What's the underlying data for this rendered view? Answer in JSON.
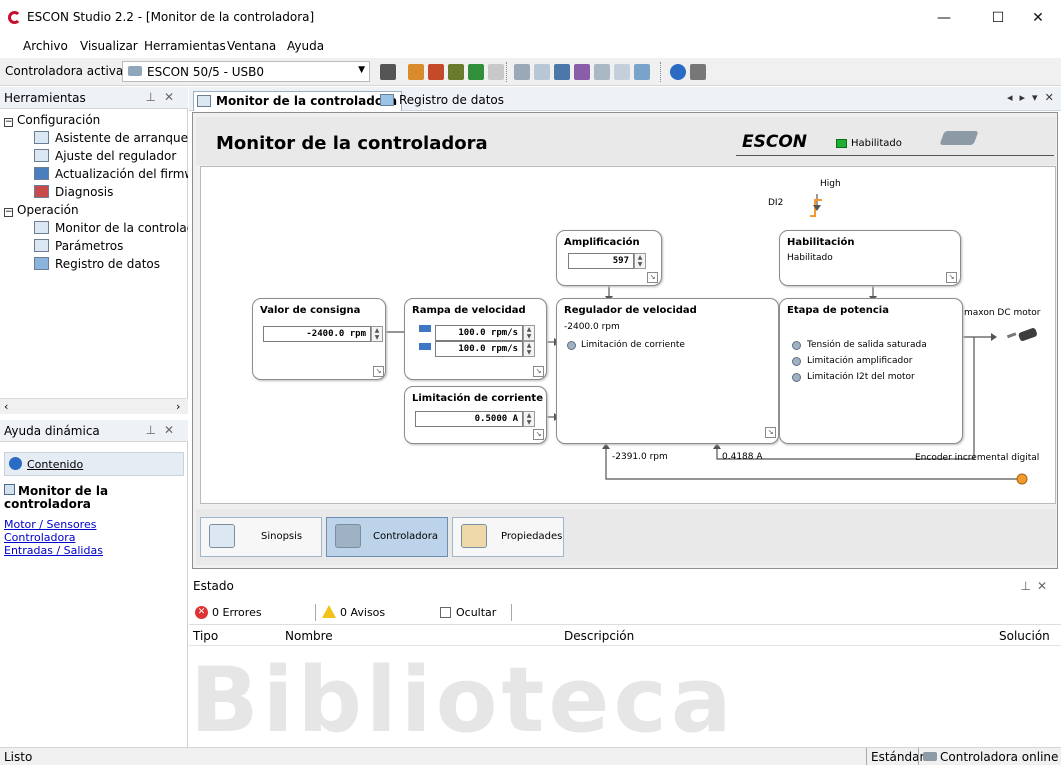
{
  "window": {
    "title": "ESCON Studio 2.2 - [Monitor de la controladora]",
    "minimize": "—",
    "maximize": "☐",
    "close": "✕"
  },
  "menu": [
    {
      "label": "Archivo"
    },
    {
      "label": "Visualizar"
    },
    {
      "label": "Herramientas"
    },
    {
      "label": "Ventana"
    },
    {
      "label": "Ayuda"
    }
  ],
  "toolbar": {
    "active_label": "Controladora activa",
    "controller_value": "ESCON 50/5 - USB0"
  },
  "tools_panel": {
    "title": "Herramientas",
    "tree": {
      "config_label": "Configuración",
      "config_items": [
        "Asistente de arranque",
        "Ajuste del regulador",
        "Actualización del firmware",
        "Diagnosis"
      ],
      "operation_label": "Operación",
      "operation_items": [
        "Monitor de la controladora",
        "Parámetros",
        "Registro de datos"
      ]
    }
  },
  "help_panel": {
    "title": "Ayuda dinámica",
    "contents_label": "Contenido",
    "topic_title": "Monitor de la controladora",
    "links": [
      "Motor / Sensores",
      "Controladora",
      "Entradas / Salidas"
    ]
  },
  "doc_tabs": [
    "Monitor de la controladora",
    "Registro de datos"
  ],
  "monitor": {
    "title": "Monitor de la controladora",
    "brand": "ESCON",
    "enabled_label": "Habilitado"
  },
  "diagram": {
    "di2_label": "DI2",
    "di2_state": "High",
    "setpoint": {
      "title": "Valor de consigna",
      "value": "-2400.0 rpm"
    },
    "ramp": {
      "title": "Rampa de velocidad",
      "accel": "100.0 rpm/s",
      "decel": "100.0 rpm/s"
    },
    "current_limit": {
      "title": "Limitación de corriente",
      "value": "0.5000 A"
    },
    "gain": {
      "title": "Amplificación",
      "value": "597"
    },
    "enable": {
      "title": "Habilitación",
      "status": "Habilitado"
    },
    "speed_controller": {
      "title": "Regulador de velocidad",
      "value": "-2400.0 rpm",
      "led_label": "Limitación de corriente"
    },
    "power_stage": {
      "title": "Etapa de potencia",
      "leds": [
        "Tensión de salida saturada",
        "Limitación amplificador",
        "Limitación I2t del motor"
      ]
    },
    "motor_label": "maxon DC motor",
    "actual_speed": "-2391.0 rpm",
    "actual_current": "0.4188 A",
    "encoder_label": "Encoder incremental digital"
  },
  "nav_buttons": [
    "Sinopsis",
    "Controladora",
    "Propiedades"
  ],
  "estado": {
    "title": "Estado",
    "errors": "0 Errores",
    "warnings": "0 Avisos",
    "hide": "Ocultar",
    "columns": [
      "Tipo",
      "Nombre",
      "Descripción",
      "Solución"
    ]
  },
  "watermark": "Biblioteca",
  "statusbar": {
    "left": "Listo",
    "mode": "Estándar",
    "connection": "Controladora online"
  }
}
